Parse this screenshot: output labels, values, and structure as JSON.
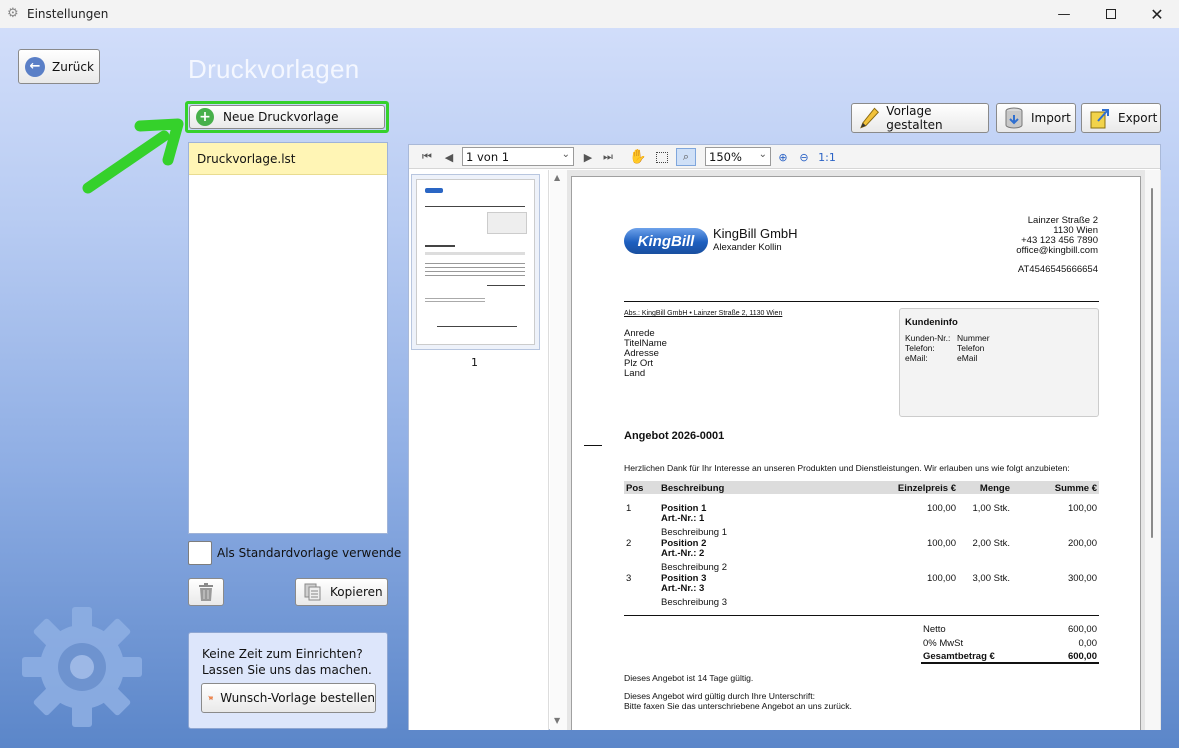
{
  "window": {
    "title": "Einstellungen"
  },
  "nav": {
    "back_label": "Zurück"
  },
  "page_title": "Druckvorlagen",
  "actions": {
    "new_template": "Neue Druckvorlage",
    "design": "Vorlage gestalten",
    "import": "Import",
    "export": "Export",
    "copy": "Kopieren"
  },
  "templates": [
    {
      "name": "Druckvorlage.lst",
      "selected": true
    }
  ],
  "standard_checkbox": {
    "label": "Als Standardvorlage verwende",
    "checked": false
  },
  "promo": {
    "line1": "Keine Zeit zum Einrichten?",
    "line2": "Lassen Sie uns das machen.",
    "button": "Wunsch-Vorlage bestellen"
  },
  "viewer": {
    "page_select": "1 von 1",
    "zoom": "150%",
    "actual_size": "1:1",
    "thumb_page": "1"
  },
  "document": {
    "logo_text": "KingBill",
    "company": "KingBill GmbH",
    "contact": "Alexander Kollin",
    "address": [
      "Lainzer Straße 2",
      "1130 Wien",
      "+43 123 456 7890",
      "office@kingbill.com"
    ],
    "vat": "AT4546545666654",
    "sender_line": "Abs.: KingBill GmbH • Lainzer Straße 2, 1130 Wien",
    "recipient": [
      "Anrede",
      "TitelName",
      "Adresse",
      "Plz Ort",
      "Land"
    ],
    "customer_info": {
      "title": "Kundeninfo",
      "rows": [
        {
          "label": "Kunden-Nr.:",
          "value": "Nummer"
        },
        {
          "label": "Telefon:",
          "value": "Telefon"
        },
        {
          "label": "eMail:",
          "value": "eMail"
        }
      ]
    },
    "heading": "Angebot 2026-0001",
    "intro": "Herzlichen Dank für Ihr Interesse an unseren Produkten und Dienstleistungen. Wir erlauben uns wie folgt anzubieten:",
    "columns": {
      "pos": "Pos",
      "desc": "Beschreibung",
      "price": "Einzelpreis €",
      "qty": "Menge",
      "sum": "Summe €"
    },
    "items": [
      {
        "pos": "1",
        "name": "Position 1",
        "art": "Art.-Nr.: 1",
        "desc": "Beschreibung 1",
        "price": "100,00",
        "qty": "1,00 Stk.",
        "sum": "100,00"
      },
      {
        "pos": "2",
        "name": "Position 2",
        "art": "Art.-Nr.: 2",
        "desc": "Beschreibung 2",
        "price": "100,00",
        "qty": "2,00 Stk.",
        "sum": "200,00"
      },
      {
        "pos": "3",
        "name": "Position 3",
        "art": "Art.-Nr.: 3",
        "desc": "Beschreibung 3",
        "price": "100,00",
        "qty": "3,00 Stk.",
        "sum": "300,00"
      }
    ],
    "totals": [
      {
        "label": "Netto",
        "value": "600,00"
      },
      {
        "label": "0% MwSt",
        "value": "0,00"
      },
      {
        "label": "Gesamtbetrag €",
        "value": "600,00"
      }
    ],
    "validity": "Dieses Angebot ist 14 Tage gültig.",
    "sign1": "Dieses Angebot wird gültig durch Ihre Unterschrift:",
    "sign2": "Bitte faxen Sie das unterschriebene Angebot an uns zurück."
  },
  "colors": {
    "highlight_green": "#35d12b",
    "selected_row": "#fff5b5",
    "brand_blue": "#1d5fbf"
  }
}
